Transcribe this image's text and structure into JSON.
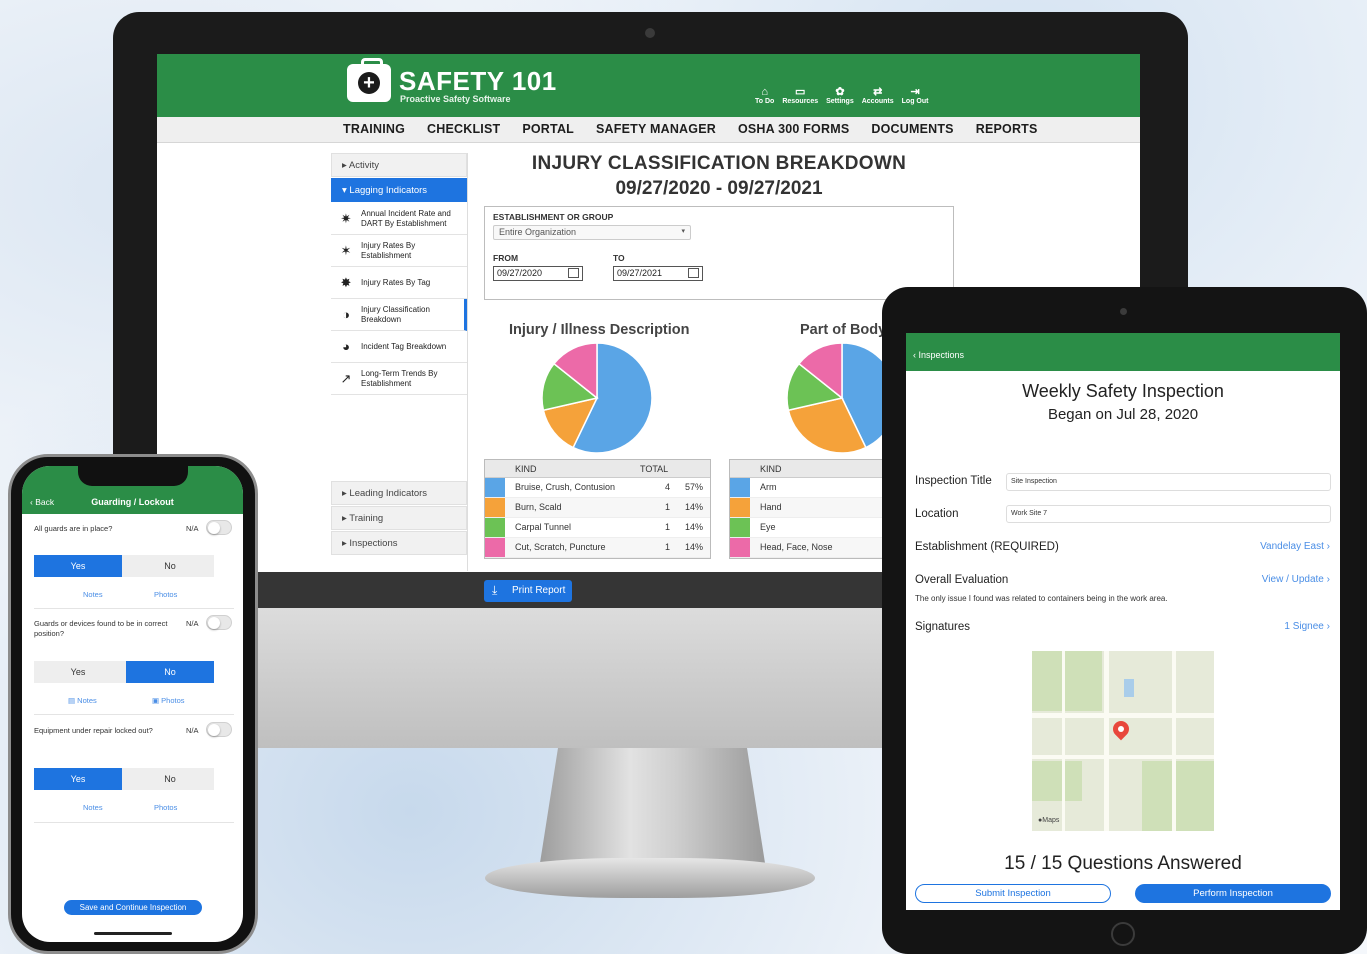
{
  "desktop": {
    "brand": {
      "title": "SAFETY 101",
      "tagline": "Proactive Safety Software"
    },
    "header_icons": [
      {
        "label": "To Do",
        "icon": "home-icon"
      },
      {
        "label": "Resources",
        "icon": "book-icon"
      },
      {
        "label": "Settings",
        "icon": "gear-icon"
      },
      {
        "label": "Accounts",
        "icon": "accounts-icon"
      },
      {
        "label": "Log Out",
        "icon": "logout-icon"
      }
    ],
    "nav": [
      "TRAINING",
      "CHECKLIST",
      "PORTAL",
      "SAFETY MANAGER",
      "OSHA 300 FORMS",
      "DOCUMENTS",
      "REPORTS"
    ],
    "sidebar": {
      "activity": "Activity",
      "lagging": "Lagging Indicators",
      "items": [
        {
          "label": "Annual Incident Rate and DART By Establishment",
          "icon": "injury-icon"
        },
        {
          "label": "Injury Rates By Establishment",
          "icon": "rates-icon"
        },
        {
          "label": "Injury Rates By Tag",
          "icon": "tag-icon"
        },
        {
          "label": "Injury Classification Breakdown",
          "icon": "pie-icon"
        },
        {
          "label": "Incident Tag Breakdown",
          "icon": "tags-icon"
        },
        {
          "label": "Long-Term Trends By Establishment",
          "icon": "trend-icon"
        }
      ],
      "leading": "Leading Indicators",
      "training": "Training",
      "inspections": "Inspections"
    },
    "report": {
      "title": "INJURY CLASSIFICATION BREAKDOWN",
      "range": "09/27/2020 - 09/27/2021",
      "establishment_label": "ESTABLISHMENT OR GROUP",
      "establishment_value": "Entire Organization",
      "from_label": "FROM",
      "from_value": "09/27/2020",
      "to_label": "TO",
      "to_value": "09/27/2021",
      "print_label": "Print Report"
    },
    "colors": {
      "blue": "#5aa5e6",
      "orange": "#f5a23a",
      "green": "#6cc255",
      "pink": "#ec6aa8"
    },
    "chart_data": [
      {
        "type": "pie",
        "title": "Injury / Illness Description",
        "columns": [
          "KIND",
          "TOTAL"
        ],
        "slices": [
          {
            "label": "Bruise, Crush, Contusion",
            "value": 4,
            "pct": "57%",
            "color": "#5aa5e6"
          },
          {
            "label": "Burn, Scald",
            "value": 1,
            "pct": "14%",
            "color": "#f5a23a"
          },
          {
            "label": "Carpal Tunnel",
            "value": 1,
            "pct": "14%",
            "color": "#6cc255"
          },
          {
            "label": "Cut, Scratch, Puncture",
            "value": 1,
            "pct": "14%",
            "color": "#ec6aa8"
          }
        ]
      },
      {
        "type": "pie",
        "title": "Part of Body",
        "columns": [
          "KIND"
        ],
        "slices": [
          {
            "label": "Arm",
            "value": 3,
            "color": "#5aa5e6"
          },
          {
            "label": "Hand",
            "value": 2,
            "color": "#f5a23a"
          },
          {
            "label": "Eye",
            "value": 1,
            "color": "#6cc255"
          },
          {
            "label": "Head, Face, Nose",
            "value": 1,
            "color": "#ec6aa8"
          }
        ]
      }
    ]
  },
  "phone": {
    "back": "Back",
    "title": "Guarding / Lockout",
    "na": "N/A",
    "yes": "Yes",
    "no": "No",
    "notes": "Notes",
    "photos": "Photos",
    "questions": [
      {
        "text": "All guards are in place?",
        "answer": "yes"
      },
      {
        "text": "Guards or devices found to be in correct position?",
        "answer": "no"
      },
      {
        "text": "Equipment under repair locked out?",
        "answer": "yes"
      }
    ],
    "save": "Save and Continue Inspection"
  },
  "tablet": {
    "back": "Inspections",
    "title": "Weekly Safety Inspection",
    "subtitle": "Began on Jul 28, 2020",
    "inspection_title_label": "Inspection Title",
    "inspection_title_value": "Site Inspection",
    "location_label": "Location",
    "location_value": "Work Site 7",
    "establishment_label": "Establishment (REQUIRED)",
    "establishment_value": "Vandelay East",
    "evaluation_label": "Overall Evaluation",
    "evaluation_link": "View / Update",
    "evaluation_text": "The only issue I found was related to containers being in the work area.",
    "signatures_label": "Signatures",
    "signatures_value": "1 Signee",
    "maps_label": "Maps",
    "questions_answered": "15 / 15 Questions Answered",
    "submit": "Submit Inspection",
    "perform": "Perform Inspection"
  }
}
